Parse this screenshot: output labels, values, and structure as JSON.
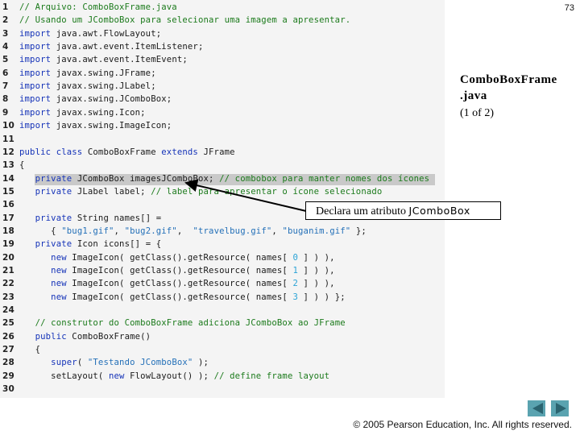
{
  "slide": {
    "page_number": "73",
    "title_line1": "ComboBoxFrame",
    "title_line2": ".java",
    "subtitle": "(1 of 2)",
    "callout_prefix": "Declara um atributo ",
    "callout_code": "JComboBox",
    "copyright": "© 2005 Pearson Education, Inc.  All rights reserved.",
    "nav": {
      "prev_icon": "previous-slide-icon",
      "next_icon": "next-slide-icon"
    },
    "colors": {
      "code_background": "#f4f4f4",
      "highlight": "#c9c9c9",
      "keyword": "#1533b8",
      "comment": "#1b7a1b",
      "string": "#2470b8",
      "nav_button": "#5aa3b0"
    }
  },
  "code": {
    "highlighted_line": 14,
    "lines": [
      {
        "n": "1",
        "indent": "",
        "tokens": [
          [
            "cm",
            "// Arquivo: ComboBoxFrame.java"
          ]
        ]
      },
      {
        "n": "2",
        "indent": "",
        "tokens": [
          [
            "cm",
            "// Usando um JComboBox para selecionar uma imagem a apresentar."
          ]
        ]
      },
      {
        "n": "3",
        "indent": "",
        "tokens": [
          [
            "kw",
            "import"
          ],
          [
            "pl",
            " java.awt.FlowLayout;"
          ]
        ]
      },
      {
        "n": "4",
        "indent": "",
        "tokens": [
          [
            "kw",
            "import"
          ],
          [
            "pl",
            " java.awt.event.ItemListener;"
          ]
        ]
      },
      {
        "n": "5",
        "indent": "",
        "tokens": [
          [
            "kw",
            "import"
          ],
          [
            "pl",
            " java.awt.event.ItemEvent;"
          ]
        ]
      },
      {
        "n": "6",
        "indent": "",
        "tokens": [
          [
            "kw",
            "import"
          ],
          [
            "pl",
            " javax.swing.JFrame;"
          ]
        ]
      },
      {
        "n": "7",
        "indent": "",
        "tokens": [
          [
            "kw",
            "import"
          ],
          [
            "pl",
            " javax.swing.JLabel;"
          ]
        ]
      },
      {
        "n": "8",
        "indent": "",
        "tokens": [
          [
            "kw",
            "import"
          ],
          [
            "pl",
            " javax.swing.JComboBox;"
          ]
        ]
      },
      {
        "n": "9",
        "indent": "",
        "tokens": [
          [
            "kw",
            "import"
          ],
          [
            "pl",
            " javax.swing.Icon;"
          ]
        ]
      },
      {
        "n": "10",
        "indent": "",
        "tokens": [
          [
            "kw",
            "import"
          ],
          [
            "pl",
            " javax.swing.ImageIcon;"
          ]
        ]
      },
      {
        "n": "11",
        "indent": "",
        "tokens": []
      },
      {
        "n": "12",
        "indent": "",
        "tokens": [
          [
            "kw",
            "public class"
          ],
          [
            "pl",
            " ComboBoxFrame "
          ],
          [
            "kw",
            "extends"
          ],
          [
            "pl",
            " JFrame"
          ]
        ]
      },
      {
        "n": "13",
        "indent": "",
        "tokens": [
          [
            "pl",
            "{"
          ]
        ]
      },
      {
        "n": "14",
        "indent": "   ",
        "tokens": [
          [
            "kw",
            "private"
          ],
          [
            "pl",
            " JComboBox imagesJComboBox; "
          ],
          [
            "cm",
            "// combobox para manter nomes dos ícones"
          ]
        ]
      },
      {
        "n": "15",
        "indent": "   ",
        "tokens": [
          [
            "kw",
            "private"
          ],
          [
            "pl",
            " JLabel label; "
          ],
          [
            "cm",
            "// label para apresentar o ícone selecionado"
          ]
        ]
      },
      {
        "n": "16",
        "indent": "",
        "tokens": []
      },
      {
        "n": "17",
        "indent": "   ",
        "tokens": [
          [
            "kw",
            "private"
          ],
          [
            "pl",
            " String names[] ="
          ]
        ]
      },
      {
        "n": "18",
        "indent": "      ",
        "tokens": [
          [
            "pl",
            "{ "
          ],
          [
            "st",
            "\"bug1.gif\""
          ],
          [
            "pl",
            ", "
          ],
          [
            "st",
            "\"bug2.gif\""
          ],
          [
            "pl",
            ",  "
          ],
          [
            "st",
            "\"travelbug.gif\""
          ],
          [
            "pl",
            ", "
          ],
          [
            "st",
            "\"buganim.gif\""
          ],
          [
            "pl",
            " };"
          ]
        ]
      },
      {
        "n": "19",
        "indent": "   ",
        "tokens": [
          [
            "kw",
            "private"
          ],
          [
            "pl",
            " Icon icons[] = {"
          ]
        ]
      },
      {
        "n": "20",
        "indent": "      ",
        "tokens": [
          [
            "kw",
            "new"
          ],
          [
            "pl",
            " ImageIcon( getClass().getResource( names[ "
          ],
          [
            "nm",
            "0"
          ],
          [
            "pl",
            " ] ) ),"
          ]
        ]
      },
      {
        "n": "21",
        "indent": "      ",
        "tokens": [
          [
            "kw",
            "new"
          ],
          [
            "pl",
            " ImageIcon( getClass().getResource( names[ "
          ],
          [
            "nm",
            "1"
          ],
          [
            "pl",
            " ] ) ),"
          ]
        ]
      },
      {
        "n": "22",
        "indent": "      ",
        "tokens": [
          [
            "kw",
            "new"
          ],
          [
            "pl",
            " ImageIcon( getClass().getResource( names[ "
          ],
          [
            "nm",
            "2"
          ],
          [
            "pl",
            " ] ) ),"
          ]
        ]
      },
      {
        "n": "23",
        "indent": "      ",
        "tokens": [
          [
            "kw",
            "new"
          ],
          [
            "pl",
            " ImageIcon( getClass().getResource( names[ "
          ],
          [
            "nm",
            "3"
          ],
          [
            "pl",
            " ] ) ) };"
          ]
        ]
      },
      {
        "n": "24",
        "indent": "",
        "tokens": []
      },
      {
        "n": "25",
        "indent": "   ",
        "tokens": [
          [
            "cm",
            "// construtor do ComboBoxFrame adiciona JComboBox ao JFrame"
          ]
        ]
      },
      {
        "n": "26",
        "indent": "   ",
        "tokens": [
          [
            "kw",
            "public"
          ],
          [
            "pl",
            " ComboBoxFrame()"
          ]
        ]
      },
      {
        "n": "27",
        "indent": "   ",
        "tokens": [
          [
            "pl",
            "{"
          ]
        ]
      },
      {
        "n": "28",
        "indent": "      ",
        "tokens": [
          [
            "kw",
            "super"
          ],
          [
            "pl",
            "( "
          ],
          [
            "st",
            "\"Testando JComboBox\""
          ],
          [
            "pl",
            " );"
          ]
        ]
      },
      {
        "n": "29",
        "indent": "      ",
        "tokens": [
          [
            "pl",
            "setLayout( "
          ],
          [
            "kw",
            "new"
          ],
          [
            "pl",
            " FlowLayout() ); "
          ],
          [
            "cm",
            "// define frame layout"
          ]
        ]
      },
      {
        "n": "30",
        "indent": "",
        "tokens": []
      }
    ]
  }
}
